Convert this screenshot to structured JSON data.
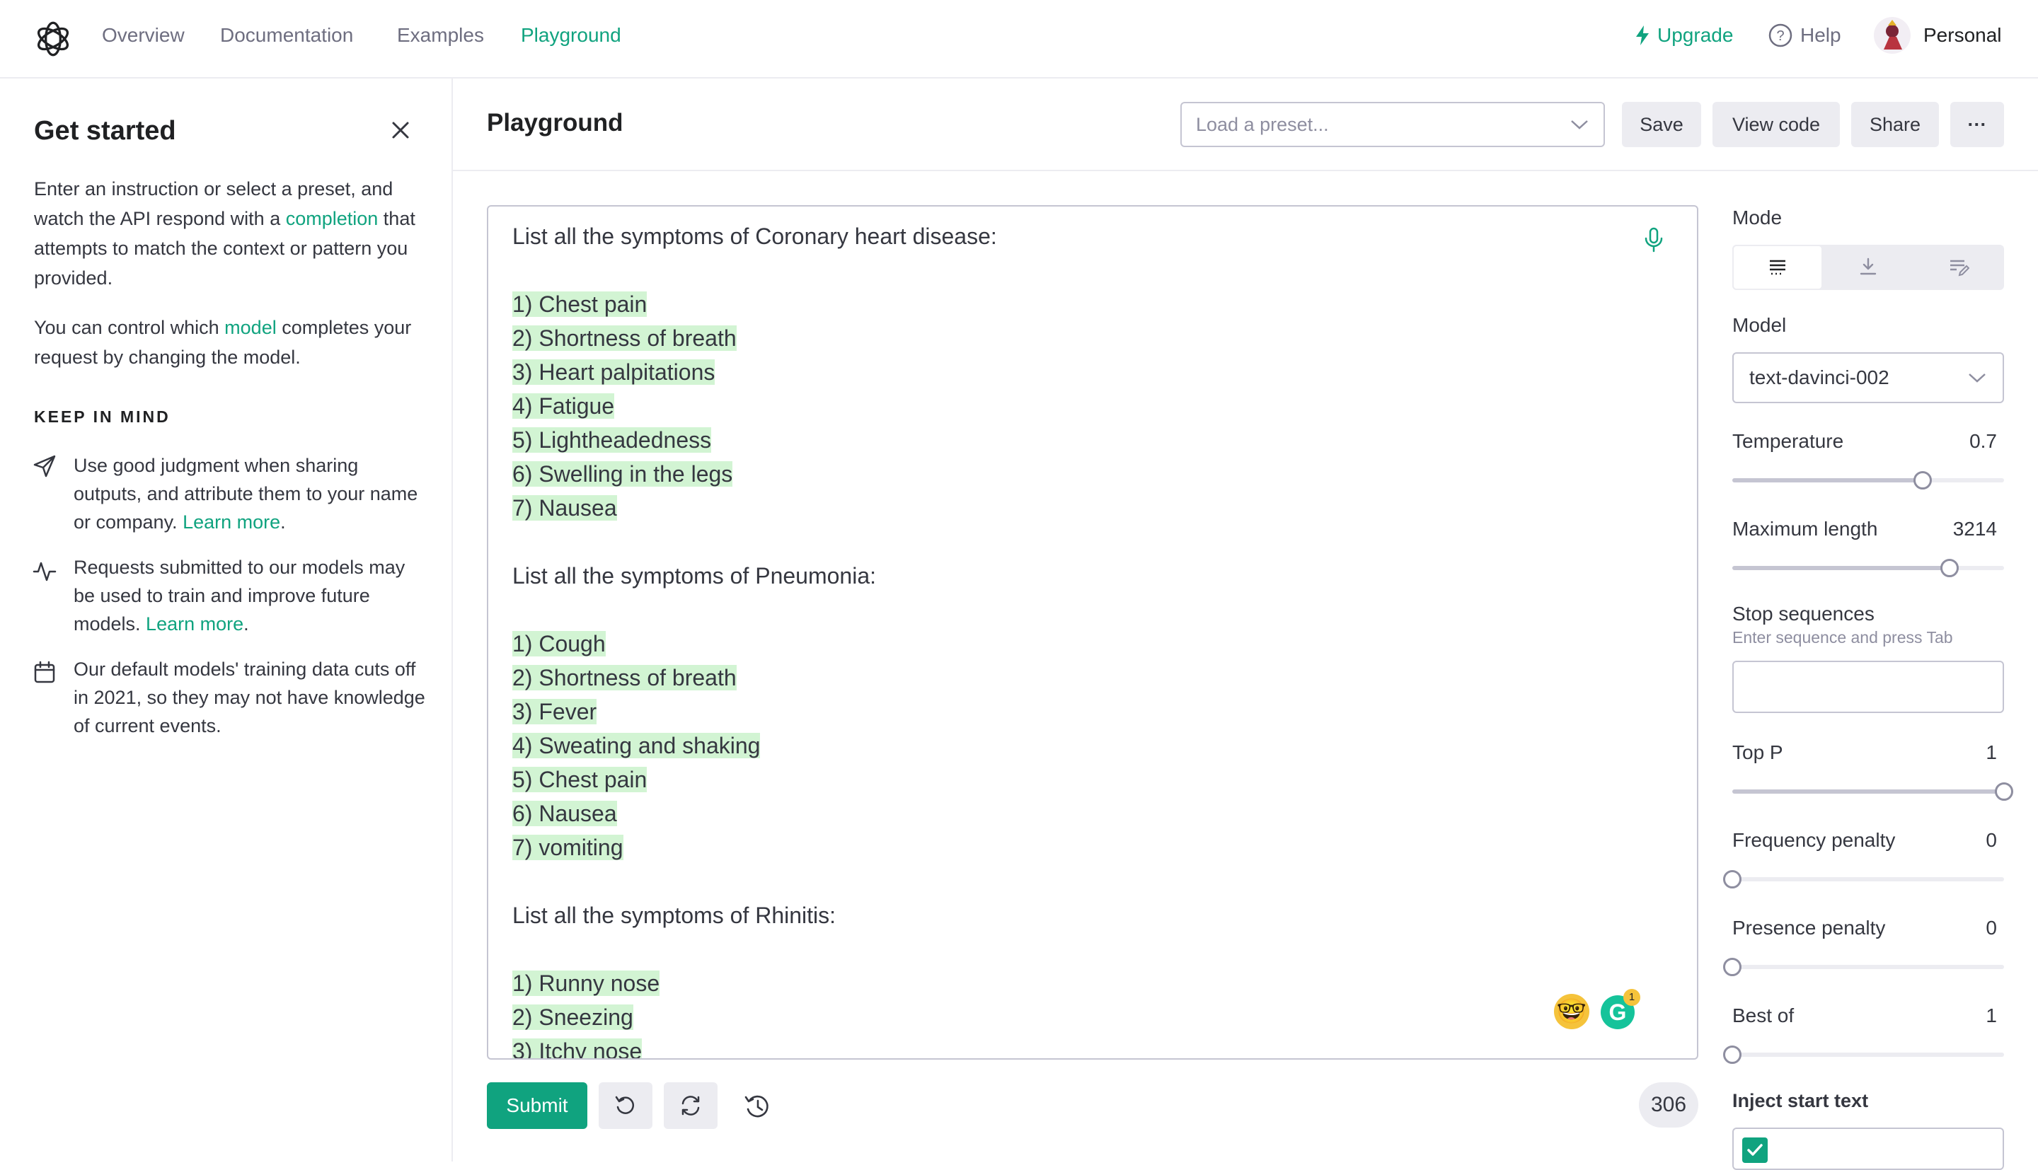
{
  "nav": {
    "links": [
      "Overview",
      "Documentation",
      "Examples",
      "Playground"
    ],
    "active": "Playground",
    "upgrade": "Upgrade",
    "help": "Help",
    "account": "Personal"
  },
  "sidebar": {
    "title": "Get started",
    "intro_before": "Enter an instruction or select a preset, and watch the API respond with a ",
    "intro_link": "completion",
    "intro_after": " that attempts to match the context or pattern you provided.",
    "control_before": "You can control which ",
    "control_link": "model",
    "control_after": " completes your request by changing the model.",
    "keep_in_mind": "KEEP IN MIND",
    "tips": [
      {
        "icon": "send-icon",
        "text": "Use good judgment when sharing outputs, and attribute them to your name or company. ",
        "link": "Learn more",
        "tail": "."
      },
      {
        "icon": "activity-icon",
        "text": "Requests submitted to our models may be used to train and improve future models. ",
        "link": "Learn more",
        "tail": "."
      },
      {
        "icon": "calendar-icon",
        "text": "Our default models' training data cuts off in 2021, so they may not have knowledge of current events.",
        "link": "",
        "tail": ""
      }
    ]
  },
  "header": {
    "title": "Playground",
    "preset_placeholder": "Load a preset...",
    "save": "Save",
    "view_code": "View code",
    "share": "Share",
    "more": "···"
  },
  "editor": {
    "lines": [
      {
        "text": "List all the symptoms of Coronary heart disease:",
        "hl": false
      },
      {
        "text": "",
        "hl": false
      },
      {
        "text": "1) Chest pain",
        "hl": true
      },
      {
        "text": "2) Shortness of breath",
        "hl": true
      },
      {
        "text": "3) Heart palpitations",
        "hl": true
      },
      {
        "text": "4) Fatigue",
        "hl": true
      },
      {
        "text": "5) Lightheadedness",
        "hl": true
      },
      {
        "text": "6) Swelling in the legs",
        "hl": true
      },
      {
        "text": "7) Nausea",
        "hl": true
      },
      {
        "text": "",
        "hl": false
      },
      {
        "text": "List all the symptoms of Pneumonia:",
        "hl": false
      },
      {
        "text": "",
        "hl": false
      },
      {
        "text": "1) Cough",
        "hl": true
      },
      {
        "text": "2) Shortness of breath",
        "hl": true
      },
      {
        "text": "3) Fever",
        "hl": true
      },
      {
        "text": "4) Sweating and shaking",
        "hl": true
      },
      {
        "text": "5) Chest pain",
        "hl": true
      },
      {
        "text": "6) Nausea",
        "hl": true
      },
      {
        "text": "7) vomiting",
        "hl": true
      },
      {
        "text": "",
        "hl": false
      },
      {
        "text": "List all the symptoms of Rhinitis:",
        "hl": false
      },
      {
        "text": "",
        "hl": false
      },
      {
        "text": "1) Runny nose",
        "hl": true
      },
      {
        "text": "2) Sneezing",
        "hl": true
      },
      {
        "text": "3) Itchy nose",
        "hl": true
      }
    ],
    "emoji": "🤓",
    "grammarly_letter": "G",
    "grammarly_badge": "1",
    "token_count": "306"
  },
  "footer": {
    "submit": "Submit"
  },
  "panel": {
    "mode_label": "Mode",
    "mode_selected": 0,
    "model_label": "Model",
    "model_value": "text-davinci-002",
    "temperature": {
      "label": "Temperature",
      "value": "0.7",
      "fraction": 0.7
    },
    "max_length": {
      "label": "Maximum length",
      "value": "3214",
      "fraction": 0.8
    },
    "stop_label": "Stop sequences",
    "stop_hint": "Enter sequence and press Tab",
    "top_p": {
      "label": "Top P",
      "value": "1",
      "fraction": 1.0
    },
    "frequency_penalty": {
      "label": "Frequency penalty",
      "value": "0",
      "fraction": 0.0
    },
    "presence_penalty": {
      "label": "Presence penalty",
      "value": "0",
      "fraction": 0.0
    },
    "best_of": {
      "label": "Best of",
      "value": "1",
      "fraction": 0.0
    },
    "inject_label": "Inject start text",
    "inject_checked": true
  },
  "colors": {
    "accent": "#10a37f",
    "highlight": "#d2f4d3",
    "border": "#c5c5d2",
    "muted": "#6e6e80"
  }
}
